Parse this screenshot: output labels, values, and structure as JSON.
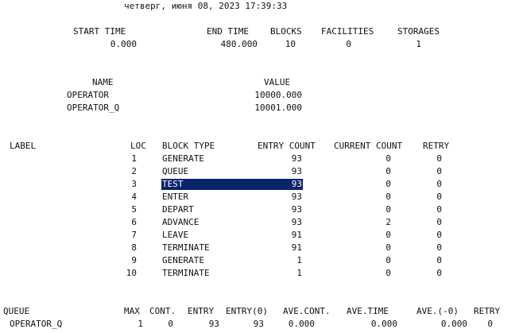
{
  "report_date": "четверг, июня 08, 2023 17:39:33",
  "summary": {
    "headers": [
      "START TIME",
      "END TIME",
      "BLOCKS",
      "FACILITIES",
      "STORAGES"
    ],
    "values": [
      "0.000",
      "480.000",
      "10",
      "0",
      "1"
    ]
  },
  "names": {
    "headers": [
      "NAME",
      "VALUE"
    ],
    "rows": [
      {
        "name": "OPERATOR",
        "value": "10000.000"
      },
      {
        "name": "OPERATOR_Q",
        "value": "10001.000"
      }
    ]
  },
  "blocks": {
    "headers": [
      "LABEL",
      "LOC",
      "BLOCK TYPE",
      "ENTRY COUNT",
      "CURRENT COUNT",
      "RETRY"
    ],
    "selected_loc": "3",
    "rows": [
      {
        "loc": "1",
        "type": "GENERATE",
        "entry": "93",
        "current": "0",
        "retry": "0"
      },
      {
        "loc": "2",
        "type": "QUEUE",
        "entry": "93",
        "current": "0",
        "retry": "0"
      },
      {
        "loc": "3",
        "type": "TEST",
        "entry": "93",
        "current": "0",
        "retry": "0"
      },
      {
        "loc": "4",
        "type": "ENTER",
        "entry": "93",
        "current": "0",
        "retry": "0"
      },
      {
        "loc": "5",
        "type": "DEPART",
        "entry": "93",
        "current": "0",
        "retry": "0"
      },
      {
        "loc": "6",
        "type": "ADVANCE",
        "entry": "93",
        "current": "2",
        "retry": "0"
      },
      {
        "loc": "7",
        "type": "LEAVE",
        "entry": "91",
        "current": "0",
        "retry": "0"
      },
      {
        "loc": "8",
        "type": "TERMINATE",
        "entry": "91",
        "current": "0",
        "retry": "0"
      },
      {
        "loc": "9",
        "type": "GENERATE",
        "entry": "1",
        "current": "0",
        "retry": "0"
      },
      {
        "loc": "10",
        "type": "TERMINATE",
        "entry": "1",
        "current": "0",
        "retry": "0"
      }
    ]
  },
  "queue": {
    "headers": [
      "QUEUE",
      "MAX",
      "CONT.",
      "ENTRY",
      "ENTRY(0)",
      "AVE.CONT.",
      "AVE.TIME",
      "AVE.(-0)",
      "RETRY"
    ],
    "rows": [
      {
        "queue": "OPERATOR_Q",
        "max": "1",
        "cont": "0",
        "entry": "93",
        "entry0": "93",
        "ave_cont": "0.000",
        "ave_time": "0.000",
        "ave_minus0": "0.000",
        "retry": "0"
      }
    ]
  }
}
